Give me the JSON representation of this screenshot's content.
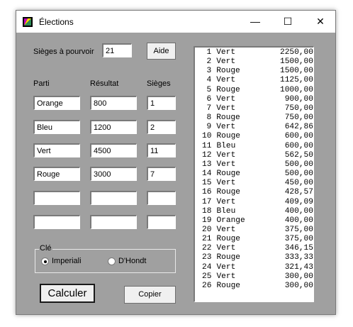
{
  "window": {
    "title": "Élections",
    "minimize_glyph": "—",
    "maximize_glyph": "☐",
    "close_glyph": "✕"
  },
  "seats": {
    "label": "Sièges à pourvoir",
    "value": "21"
  },
  "help_button": "Aide",
  "columns": {
    "party": "Parti",
    "result": "Résultat",
    "seats": "Sièges"
  },
  "parties": [
    {
      "name": "Orange",
      "result": "800",
      "seats": "1"
    },
    {
      "name": "Bleu",
      "result": "1200",
      "seats": "2"
    },
    {
      "name": "Vert",
      "result": "4500",
      "seats": "11"
    },
    {
      "name": "Rouge",
      "result": "3000",
      "seats": "7"
    },
    {
      "name": "",
      "result": "",
      "seats": ""
    },
    {
      "name": "",
      "result": "",
      "seats": ""
    }
  ],
  "key": {
    "label": "Clé",
    "options": [
      {
        "label": "Imperiali",
        "selected": true
      },
      {
        "label": "D'Hondt",
        "selected": false
      }
    ]
  },
  "calculate_button": "Calculer",
  "copy_button": "Copier",
  "results": [
    {
      "n": "1",
      "party": "Vert",
      "value": "2250,00"
    },
    {
      "n": "2",
      "party": "Vert",
      "value": "1500,00"
    },
    {
      "n": "3",
      "party": "Rouge",
      "value": "1500,00"
    },
    {
      "n": "4",
      "party": "Vert",
      "value": "1125,00"
    },
    {
      "n": "5",
      "party": "Rouge",
      "value": "1000,00"
    },
    {
      "n": "6",
      "party": "Vert",
      "value": "900,00"
    },
    {
      "n": "7",
      "party": "Vert",
      "value": "750,00"
    },
    {
      "n": "8",
      "party": "Rouge",
      "value": "750,00"
    },
    {
      "n": "9",
      "party": "Vert",
      "value": "642,86"
    },
    {
      "n": "10",
      "party": "Rouge",
      "value": "600,00"
    },
    {
      "n": "11",
      "party": "Bleu",
      "value": "600,00"
    },
    {
      "n": "12",
      "party": "Vert",
      "value": "562,50"
    },
    {
      "n": "13",
      "party": "Vert",
      "value": "500,00"
    },
    {
      "n": "14",
      "party": "Rouge",
      "value": "500,00"
    },
    {
      "n": "15",
      "party": "Vert",
      "value": "450,00"
    },
    {
      "n": "16",
      "party": "Rouge",
      "value": "428,57"
    },
    {
      "n": "17",
      "party": "Vert",
      "value": "409,09"
    },
    {
      "n": "18",
      "party": "Bleu",
      "value": "400,00"
    },
    {
      "n": "19",
      "party": "Orange",
      "value": "400,00"
    },
    {
      "n": "20",
      "party": "Vert",
      "value": "375,00"
    },
    {
      "n": "21",
      "party": "Rouge",
      "value": "375,00"
    },
    {
      "n": "22",
      "party": "Vert",
      "value": "346,15"
    },
    {
      "n": "23",
      "party": "Rouge",
      "value": "333,33"
    },
    {
      "n": "24",
      "party": "Vert",
      "value": "321,43"
    },
    {
      "n": "25",
      "party": "Vert",
      "value": "300,00"
    },
    {
      "n": "26",
      "party": "Rouge",
      "value": "300,00"
    }
  ]
}
